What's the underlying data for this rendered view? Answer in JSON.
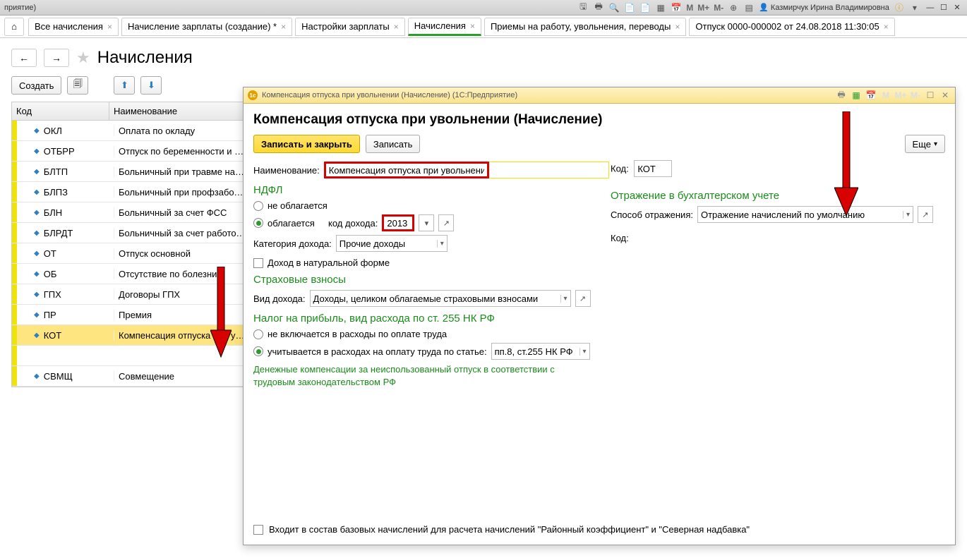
{
  "topbar": {
    "left_fragment": "приятие)",
    "m_labels": [
      "M",
      "M+",
      "M-"
    ],
    "user_name": "Казмирчук Ирина Владимировна"
  },
  "tabs": [
    {
      "label": "Все начисления",
      "closable": true,
      "active": false
    },
    {
      "label": "Начисление зарплаты (создание) *",
      "closable": true,
      "active": false
    },
    {
      "label": "Настройки зарплаты",
      "closable": true,
      "active": false
    },
    {
      "label": "Начисления",
      "closable": true,
      "active": true
    },
    {
      "label": "Приемы на работу, увольнения, переводы",
      "closable": true,
      "active": false
    },
    {
      "label": "Отпуск 0000-000002 от 24.08.2018 11:30:05",
      "closable": true,
      "active": false
    }
  ],
  "page": {
    "title": "Начисления"
  },
  "toolbar": {
    "create": "Создать"
  },
  "list": {
    "col_code": "Код",
    "col_name": "Наименование",
    "rows": [
      {
        "code": "ОКЛ",
        "name": "Оплата по окладу"
      },
      {
        "code": "ОТБРР",
        "name": "Отпуск по беременности и родам"
      },
      {
        "code": "БЛТП",
        "name": "Больничный при травме на производстве"
      },
      {
        "code": "БЛПЗ",
        "name": "Больничный при профзаболевании"
      },
      {
        "code": "БЛН",
        "name": "Больничный за счет ФСС"
      },
      {
        "code": "БЛРДТ",
        "name": "Больничный за счет работодателя"
      },
      {
        "code": "ОТ",
        "name": "Отпуск основной"
      },
      {
        "code": "ОБ",
        "name": "Отсутствие по болезни"
      },
      {
        "code": "ГПХ",
        "name": "Договоры ГПХ"
      },
      {
        "code": "ПР",
        "name": "Премия"
      },
      {
        "code": "КОТ",
        "name": "Компенсация отпуска при увольнении",
        "sel": true
      },
      {
        "code": "",
        "name": "",
        "blank": true
      },
      {
        "code": "СВМЩ",
        "name": "Совмещение"
      }
    ]
  },
  "dialog": {
    "title_text": "Компенсация отпуска при увольнении (Начисление)  (1С:Предприятие)",
    "heading": "Компенсация отпуска при увольнении (Начисление)",
    "save_close": "Записать и закрыть",
    "save": "Записать",
    "more": "Еще",
    "name_label": "Наименование:",
    "name_value": "Компенсация отпуска при увольнении",
    "code_label": "Код:",
    "code_value": "КОТ",
    "ndfl_title": "НДФЛ",
    "ndfl_opt1": "не облагается",
    "ndfl_opt2": "облагается",
    "income_code_label": "код дохода:",
    "income_code_value": "2013",
    "income_cat_label": "Категория дохода:",
    "income_cat_value": "Прочие доходы",
    "natural_income": "Доход в натуральной форме",
    "insurance_title": "Страховые взносы",
    "income_type_label": "Вид дохода:",
    "income_type_value": "Доходы, целиком облагаемые страховыми взносами",
    "profit_title": "Налог на прибыль, вид расхода по ст. 255 НК РФ",
    "profit_opt1": "не включается в расходы по оплате труда",
    "profit_opt2": "учитывается в расходах на оплату труда по статье:",
    "profit_article": "пп.8, ст.255 НК РФ",
    "hint_text": "Денежные компенсации за неиспользованный отпуск в соответствии с трудовым законодательством РФ",
    "acct_title": "Отражение в бухгалтерском учете",
    "acct_method_label": "Способ отражения:",
    "acct_method_value": "Отражение начислений по умолчанию",
    "footer_chk": "Входит в состав базовых начислений для расчета начислений \"Районный коэффициент\" и \"Северная надбавка\""
  }
}
